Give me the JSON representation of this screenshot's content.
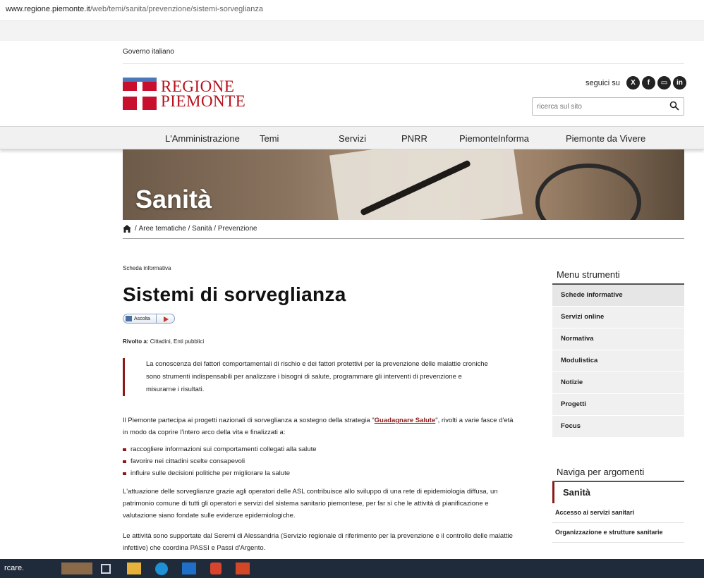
{
  "browser": {
    "url_host": "www.regione.piemonte.it",
    "url_path": "/web/temi/sanita/prevenzione/sistemi-sorveglianza"
  },
  "header": {
    "gov_link": "Governo italiano",
    "logo_line1": "REGIONE",
    "logo_line2": "PIEMONTE",
    "follow_label": "seguici su",
    "search_placeholder": "ricerca sul sito"
  },
  "nav": {
    "items": [
      "L'Amministrazione",
      "Temi",
      "Servizi",
      "PNRR",
      "PiemonteInforma",
      "Piemonte da Vivere"
    ]
  },
  "hero": {
    "title": "Sanità"
  },
  "breadcrumb": {
    "items": [
      "Aree tematiche",
      "Sanità",
      "Prevenzione"
    ]
  },
  "article": {
    "kicker": "Scheda informativa",
    "title": "Sistemi di sorveglianza",
    "listen_label": "Ascolta",
    "audience_label": "Rivolto a:",
    "audience_value": "Cittadini, Enti pubblici",
    "quote": "La conoscenza dei fattori comportamentali di rischio e dei fattori protettivi per la prevenzione delle malattie croniche sono strumenti indispensabili per analizzare i bisogni di salute, programmare gli interventi di prevenzione e misurarne i risultati.",
    "p1_before": "Il Piemonte partecipa ai progetti nazionali di sorveglianza a sostegno della strategia \"",
    "p1_link": "Guadagnare Salute",
    "p1_after": "\", rivolti a varie fasce d'età in modo da coprire l'intero arco della vita e finalizzati a:",
    "bullets": [
      "raccogliere informazioni sui comportamenti collegati alla salute",
      "favorire nei cittadini scelte consapevoli",
      "influire sulle decisioni politiche per migliorare la salute"
    ],
    "p2": "L'attuazione delle sorveglianze grazie agli operatori delle ASL contribuisce allo sviluppo di una rete di epidemiologia diffusa, un patrimonio comune di tutti gli operatori e servizi del sistema sanitario piemontese, per far sì che le attività di pianificazione e valutazione siano fondate sulle evidenze epidemiologiche.",
    "p3": "Le attività sono supportate dal Seremi di Alessandria (Servizio regionale di riferimento per la prevenzione e il controllo delle malattie infettive) che coordina PASSI e Passi d'Argento."
  },
  "sidebar": {
    "tools_title": "Menu strumenti",
    "tools": [
      "Schede informative",
      "Servizi online",
      "Normativa",
      "Modulistica",
      "Notizie",
      "Progetti",
      "Focus"
    ],
    "topics_title": "Naviga per argomenti",
    "topic_selected": "Sanità",
    "topics": [
      "Accesso ai servizi sanitari",
      "Organizzazione e strutture sanitarie"
    ]
  },
  "taskbar": {
    "search_text": "rcare."
  },
  "colors": {
    "brand": "#b5121b",
    "accent": "#8b1a1a",
    "nav_bg": "#f1f1f1",
    "taskbar": "#1f2b3a"
  },
  "icons": [
    "x-icon",
    "facebook-icon",
    "youtube-icon",
    "linkedin-icon",
    "search-icon",
    "home-icon",
    "speaker-icon",
    "play-icon"
  ]
}
